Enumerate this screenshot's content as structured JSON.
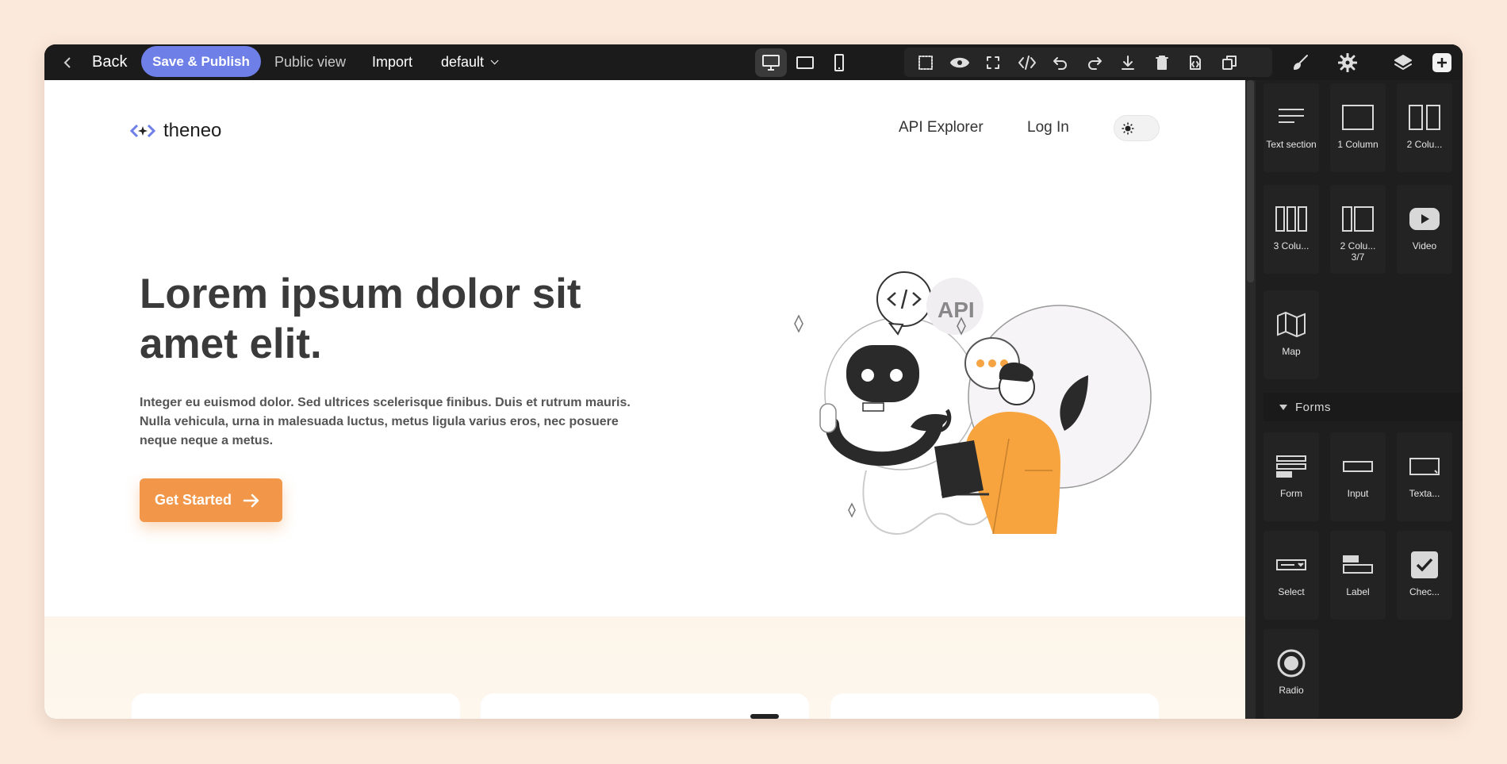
{
  "toolbar": {
    "back_label": "Back",
    "save_label": "Save & Publish",
    "public_label": "Public view",
    "import_label": "Import",
    "default_label": "default",
    "device_icons": [
      "desktop-icon",
      "tablet-icon",
      "mobile-icon"
    ],
    "action_icons": [
      "select-box-icon",
      "eye-icon",
      "fullscreen-icon",
      "code-icon",
      "undo-icon",
      "redo-icon",
      "download-icon",
      "trash-icon",
      "file-code-icon",
      "copy-icon"
    ],
    "right_icons": [
      "paint-brush-icon",
      "gear-icon",
      "layers-icon",
      "plus-square-icon"
    ],
    "accent": "#6f7fe8"
  },
  "site": {
    "logo_text": "theneo",
    "nav": [
      "API Explorer",
      "Log In"
    ],
    "hero_title": "Lorem ipsum dolor sit amet elit.",
    "hero_body": "Integer eu euismod dolor. Sed ultrices scelerisque finibus. Duis et rutrum mauris. Nulla vehicula, urna in malesuada luctus, metus ligula varius eros, nec posuere neque neque a metus.",
    "cta_label": "Get Started",
    "cta_color": "#f2974a",
    "illustration_text": "API"
  },
  "panel": {
    "blocks": [
      {
        "label": "Text section",
        "icon": "text-section-icon"
      },
      {
        "label": "1 Column",
        "icon": "one-column-icon"
      },
      {
        "label": "2 Colu...",
        "icon": "two-column-icon"
      },
      {
        "label": "3 Colu...",
        "icon": "three-column-icon"
      },
      {
        "label": "2 Colu... 3/7",
        "icon": "two-column-37-icon"
      },
      {
        "label": "Video",
        "icon": "video-icon"
      },
      {
        "label": "Map",
        "icon": "map-icon"
      }
    ],
    "forms_category": "Forms",
    "form_blocks": [
      {
        "label": "Form",
        "icon": "form-icon"
      },
      {
        "label": "Input",
        "icon": "input-icon"
      },
      {
        "label": "Texta...",
        "icon": "textarea-icon"
      },
      {
        "label": "Select",
        "icon": "select-icon"
      },
      {
        "label": "Label",
        "icon": "label-icon"
      },
      {
        "label": "Chec...",
        "icon": "checkbox-icon"
      },
      {
        "label": "Radio",
        "icon": "radio-icon"
      }
    ]
  }
}
